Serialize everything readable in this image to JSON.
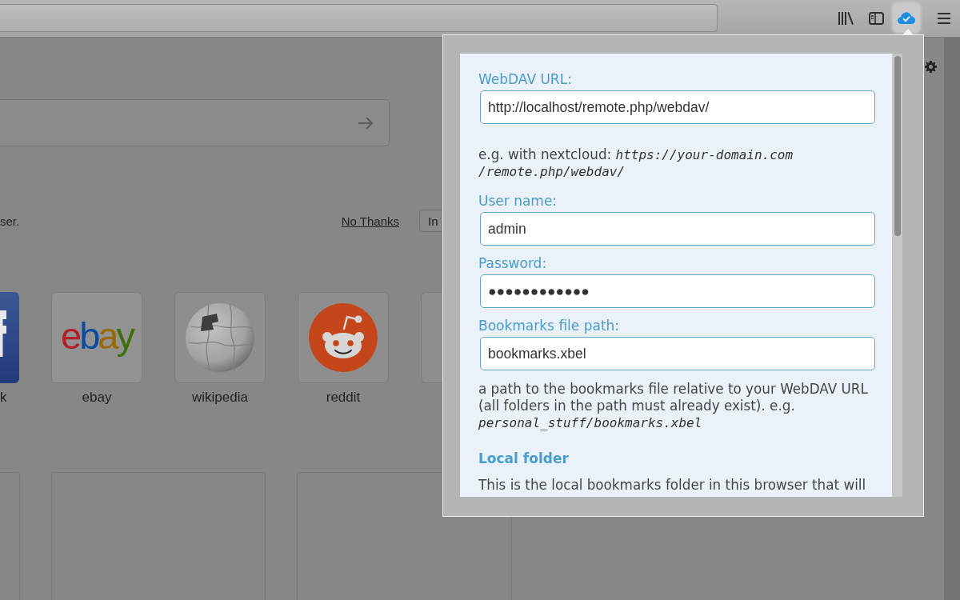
{
  "toolbar": {
    "buttons": [
      {
        "kind": "library",
        "open": false
      },
      {
        "kind": "sidebar",
        "open": false
      },
      {
        "kind": "sync",
        "open": true
      },
      {
        "kind": "menu",
        "open": false
      }
    ]
  },
  "page": {
    "snippet": {
      "text": "ser.",
      "link": "No Thanks",
      "button": "In"
    },
    "top_sites": [
      {
        "kind": "letter",
        "label": "k"
      },
      {
        "kind": "wordmark",
        "logo": "ebay",
        "label": "ebay"
      },
      {
        "kind": "globe",
        "label": "wikipedia"
      },
      {
        "kind": "mascot",
        "label": "reddit"
      },
      {
        "kind": "empty"
      }
    ]
  },
  "popup": {
    "fields": [
      {
        "label": "WebDAV URL:",
        "value": "http://localhost/remote.php/webdav/",
        "help": "e.g. with nextcloud: *https://your-domain.com /remote.php/webdav/*"
      },
      {
        "label": "User name:",
        "value": "admin"
      },
      {
        "label": "Password:",
        "value": "●●●●●●●●●●●●"
      },
      {
        "label": "Bookmarks file path:",
        "value": "bookmarks.xbel",
        "help": "a path to the bookmarks file relative to your WebDAV URL (all folders in the path must already exist). e.g. *personal_stuff/bookmarks.xbel*"
      }
    ],
    "sections": [
      {
        "heading": "Local folder",
        "text": "This is the local bookmarks folder in this browser that will"
      }
    ]
  }
}
